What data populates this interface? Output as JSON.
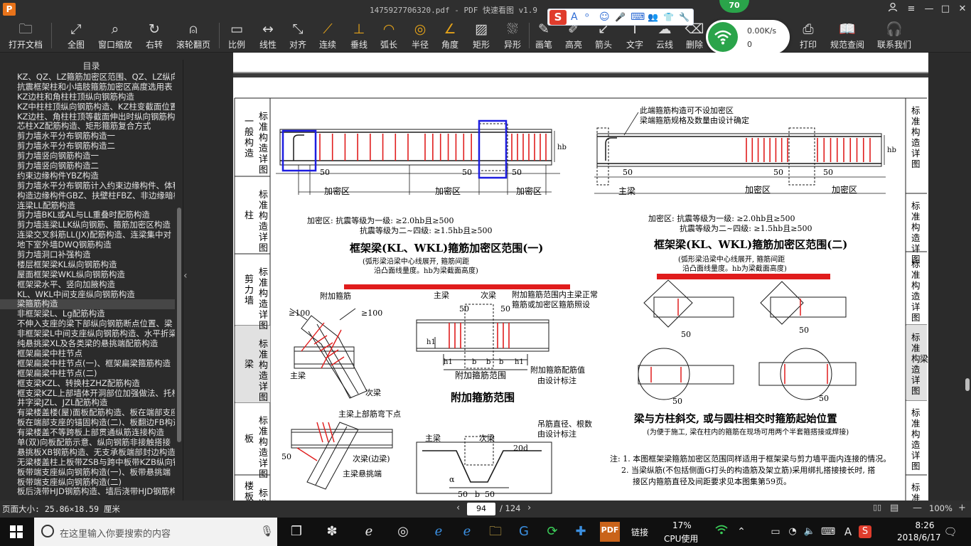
{
  "window": {
    "title": "1475927706320.pdf - PDF 快速看图 v1.9",
    "logo": "P",
    "controls": {
      "user": "user-icon",
      "minimize": "—",
      "maximize": "□",
      "close": "✕"
    }
  },
  "toolbar": {
    "items": [
      {
        "id": "open",
        "label": "打开文档",
        "icon": "folder-icon"
      },
      {
        "id": "fit-all",
        "label": "全图",
        "icon": "expand-icon"
      },
      {
        "id": "window-zoom",
        "label": "窗口缩放",
        "icon": "magnifier-icon"
      },
      {
        "id": "rotate-right",
        "label": "右转",
        "icon": "rotate-icon"
      },
      {
        "id": "scroll-page",
        "label": "滚轮翻页",
        "icon": "mouse-icon"
      },
      {
        "id": "scale",
        "label": "比例",
        "icon": "ruler-icon"
      },
      {
        "id": "linear",
        "label": "线性",
        "icon": "linear-measure-icon"
      },
      {
        "id": "aligned",
        "label": "对齐",
        "icon": "aligned-measure-icon"
      },
      {
        "id": "continuous",
        "label": "连续",
        "icon": "polyline-icon"
      },
      {
        "id": "perpendicular",
        "label": "垂线",
        "icon": "perpendicular-icon"
      },
      {
        "id": "arc-length",
        "label": "弧长",
        "icon": "arc-icon"
      },
      {
        "id": "radius",
        "label": "半径",
        "icon": "radius-icon"
      },
      {
        "id": "angle",
        "label": "角度",
        "icon": "angle-icon"
      },
      {
        "id": "rectangle",
        "label": "矩形",
        "icon": "rectangle-area-icon"
      },
      {
        "id": "irregular",
        "label": "异形",
        "icon": "irregular-area-icon"
      },
      {
        "id": "pen",
        "label": "画笔",
        "icon": "pen-icon"
      },
      {
        "id": "highlight",
        "label": "高亮",
        "icon": "highlighter-icon"
      },
      {
        "id": "arrow",
        "label": "箭头",
        "icon": "arrow-icon"
      },
      {
        "id": "text",
        "label": "文字",
        "icon": "text-icon"
      },
      {
        "id": "cloud",
        "label": "云线",
        "icon": "cloud-line-icon"
      },
      {
        "id": "delete",
        "label": "删除",
        "icon": "eraser-icon"
      },
      {
        "id": "print",
        "label": "打印",
        "icon": "printer-icon"
      },
      {
        "id": "code-query",
        "label": "规范查阅",
        "icon": "book-icon"
      },
      {
        "id": "contact",
        "label": "联系我们",
        "icon": "headset-icon"
      }
    ]
  },
  "ime_bar": {
    "logo": "S",
    "glyphs": [
      "A",
      "ᵒ",
      "☺",
      "🎤",
      "⌨",
      "👥",
      "👕",
      "🔧"
    ]
  },
  "network_widget": {
    "badge": "70",
    "speed": "0.00K/s",
    "count": "0"
  },
  "sidebar": {
    "title": "目录",
    "selected_index": 24,
    "items": [
      "KZ、QZ、LZ箍筋加密区范围、QZ、LZ纵向钢筋",
      "抗震框架柱和小墙肢箍筋加密区高度选用表",
      "KZ边柱和角柱柱顶纵向钢筋构造",
      "KZ中柱柱顶纵向钢筋构造、KZ柱变截面位置",
      "KZ边柱、角柱柱顶等截面伸出时纵向钢筋构",
      "芯柱XZ配筋构造、矩形箍筋复合方式",
      "剪力墙水平分布钢筋构造一",
      "剪力墙水平分布钢筋构造二",
      "剪力墙竖向钢筋构造一",
      "剪力墙竖向钢筋构造二",
      "约束边缘构件YBZ构造",
      "剪力墙水平分布钢筋计入约束边缘构件、体积",
      "构造边缘构件GBZ、扶壁柱FBZ、非边缘暗柱",
      "连梁LL配筋构造",
      "剪力墙BKL或AL与LL重叠时配筋构造",
      "剪力墙连梁LLK纵向钢筋、箍筋加密区构造",
      "连梁交叉斜筋LL(JX)配筋构造、连梁集中对",
      "地下室外墙DWQ钢筋构造",
      "剪力墙洞口补强构造",
      "楼层框架梁KL纵向钢筋构造",
      "屋面框架梁WKL纵向钢筋构造",
      "框架梁水平、竖向加腋构造",
      "KL、WKL中间支座纵向钢筋构造",
      "梁箍筋构造",
      "非框架梁L、Lg配筋构造",
      "不伸入支座的梁下部纵向钢筋断点位置、梁",
      "非框架梁L中间支座纵向钢筋构造、水平折梁",
      "纯悬挑梁XL及各类梁的悬挑端配筋构造",
      "框架扁梁中柱节点",
      "框架扁梁中柱节点(一)、框架扁梁箍筋构造",
      "框架扁梁中柱节点(二)",
      "框支梁KZL、转换柱ZHZ配筋构造",
      "框支梁KZL上部墙体开洞部位加强做法、托柱",
      "井字梁JZL、JZL配筋构造",
      "有梁楼盖楼(屋)面板配筋构造、板在端部支座",
      "板在端部支座的锚固构造(二)、板翻边FB构造",
      "有梁楼盖不等跨板上部贯通纵筋连接构造",
      "单(双)向板配筋示意、纵向钢筋非接触搭接",
      "悬挑板XB钢筋构造、无支承板端部封边构造",
      "无梁楼盖柱上板带ZSB与跨中板带KZB纵向钢",
      "板带端支座纵向钢筋构造(一)、板带悬挑端",
      "板带端支座纵向钢筋构造(二)",
      "板后浇带HJD钢筋构造、墙后浇带HJD钢筋构"
    ]
  },
  "drawing": {
    "left_labels": [
      [
        "标",
        "准",
        "构",
        "造",
        "详",
        "图"
      ],
      [
        "标",
        "准",
        "构",
        "造",
        "详",
        "图"
      ],
      [
        "标",
        "准",
        "构",
        "造",
        "详",
        "图"
      ],
      [
        "标",
        "准",
        "构",
        "造",
        "详",
        "图"
      ],
      [
        "标",
        "准",
        "构",
        "造",
        "详",
        "图"
      ],
      [
        "标",
        "准"
      ]
    ],
    "left_tabs": [
      "一般构造",
      "柱",
      "剪力墙",
      "梁",
      "板",
      "楼板"
    ],
    "right_labels": [
      "标准构造详图",
      "标准构造详图",
      "标准构造详图",
      "标准构造详图",
      "标准构造详图",
      "标准"
    ],
    "right_tabs": [
      "",
      "",
      "",
      "梁",
      "",
      ""
    ],
    "note_top": "此端箍筋构造可不设加密区",
    "note_top2": "梁端箍筋规格及数量由设计确定",
    "dense_zone": "加密区",
    "main_beam": "主梁",
    "dim_50": "50",
    "hb": "hb",
    "dense_desc_1": "加密区: 抗震等级为一级: ≥2.0hb且≥500",
    "dense_desc_2": "抗震等级为二~四级: ≥1.5hb且≥500",
    "title1": "框架梁(KL、WKL)箍筋加密区范围(一)",
    "title1_sub1": "(弧形梁沿梁中心线展开, 箍筋间距",
    "title1_sub2": "沿凸面线量度。hb为梁截面高度)",
    "title2": "框架梁(KL、WKL)箍筋加密区范围(二)",
    "title2_sub1": "(弧形梁沿梁中心线展开, 箍筋间距",
    "title2_sub2": "沿凸面线量度。hb为梁截面高度)",
    "add_stirrup": "附加箍筋",
    "dim_100": "≥100",
    "sub_beam": "次梁",
    "add_note1": "附加箍筋范围内主梁正常",
    "add_note2": "箍筋或加密区箍筋照设",
    "add_range_label": "附加箍筋范围",
    "add_value1": "附加箍筋配筋值",
    "add_value2": "由设计标注",
    "add_title": "附加箍筋范围",
    "h1": "h1",
    "b": "b",
    "upper_bent": "主梁上部筋弯下点",
    "sub_side": "次梁(边梁)",
    "cantilever": "主梁悬挑端",
    "hanger1": "吊筋直径、根数",
    "hanger2": "由设计标注",
    "d20": "20d",
    "alpha": "α",
    "diag_title": "梁与方柱斜交, 或与圆柱相交时箍筋起始位置",
    "diag_sub": "(为便于施工, 梁在柱内的箍筋在现场可用两个半套箍搭接或焊接)",
    "note1": "注: 1. 本图框架梁箍筋加密区范围同样适用于框架梁与剪力墙平面内连接的情况。",
    "note2": "2. 当梁纵筋(不包括侧面G打头的构造筋及架立筋)采用绑扎搭接接长时, 搭",
    "note3": "接区内箍筋直径及间距要求见本图集第59页。",
    "colors": {
      "red": "#e01c1c",
      "blue": "#1d1de0",
      "ink": "#1a1a1a"
    }
  },
  "status": {
    "page_size": "页面大小: 25.86×18.59 厘米",
    "current_page": "94",
    "total_pages": "/ 124",
    "zoom": "100%"
  },
  "taskbar": {
    "search_placeholder": "在这里输入你要搜索的内容",
    "link_label": "链接",
    "cpu_percent": "17%",
    "cpu_label": "CPU使用",
    "time": "8:26",
    "date": "2018/6/17",
    "ime_char": "A",
    "notif_count": ""
  }
}
